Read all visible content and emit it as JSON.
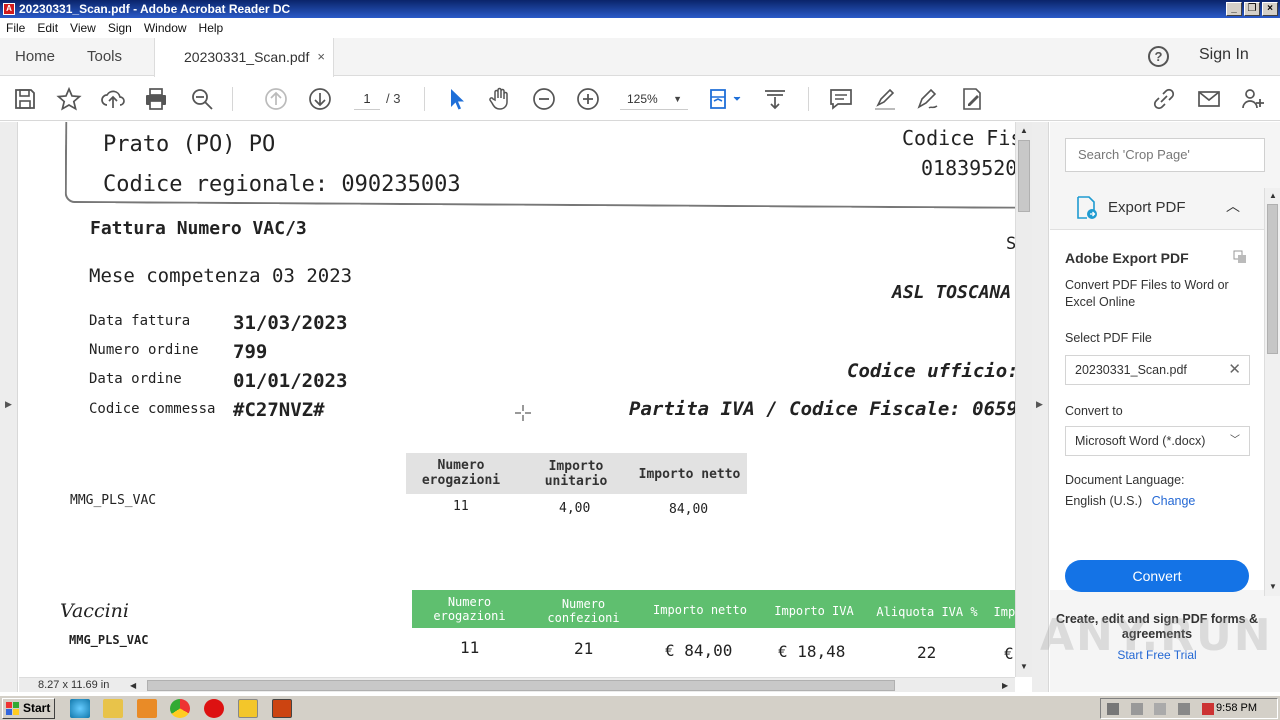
{
  "window": {
    "title": "20230331_Scan.pdf - Adobe Acrobat Reader DC"
  },
  "menu": [
    "File",
    "Edit",
    "View",
    "Sign",
    "Window",
    "Help"
  ],
  "tabs": {
    "home": "Home",
    "tools": "Tools",
    "document": "20230331_Scan.pdf",
    "close": "×"
  },
  "header": {
    "help": "?",
    "sign_in": "Sign In"
  },
  "toolbar": {
    "page_current": "1",
    "page_total": "/ 3",
    "zoom": "125%"
  },
  "document": {
    "prato": "Prato (PO) PO",
    "codice_regionale": "Codice regionale: 090235003",
    "codice_fiscale_label": "Codice Fis",
    "codice_fiscale_value": "01839520",
    "fattura": "Fattura Numero VAC/3",
    "s_char": "S",
    "mese": "Mese competenza  03 2023",
    "asl": "ASL TOSCANA",
    "fields": [
      {
        "label": "Data fattura",
        "value": "31/03/2023"
      },
      {
        "label": "Numero ordine",
        "value": "799"
      },
      {
        "label": "Data ordine",
        "value": "01/01/2023"
      },
      {
        "label": "Codice commessa",
        "value": "#C27NVZ#"
      }
    ],
    "codice_ufficio": "Codice ufficio:",
    "partita_iva": "Partita IVA / Codice Fiscale: 0659",
    "table1": {
      "headers": [
        "Numero\nerogazioni",
        "Importo\nunitario",
        "Importo netto"
      ],
      "row_label": "MMG_PLS_VAC",
      "values": [
        "11",
        "4,00",
        "84,00"
      ]
    },
    "vaccini": "Vaccini",
    "table2": {
      "headers": [
        "Numero\nerogazioni",
        "Numero\nconfezioni",
        "Importo netto",
        "Importo IVA",
        "Aliquota IVA %",
        "Impo"
      ],
      "row_label": "MMG_PLS_VAC",
      "values": [
        "11",
        "21",
        "€ 84,00",
        "€ 18,48",
        "22",
        "€"
      ]
    }
  },
  "status": {
    "page_size": "8.27 x 11.69 in"
  },
  "right_panel": {
    "search_placeholder": "Search 'Crop Page'",
    "export_label": "Export PDF",
    "card_title": "Adobe Export PDF",
    "card_desc": "Convert PDF Files to Word or Excel Online",
    "select_file": "Select PDF File",
    "file_name": "20230331_Scan.pdf",
    "convert_to_label": "Convert to",
    "convert_to_value": "Microsoft Word (*.docx)",
    "doc_lang_label": "Document Language:",
    "doc_lang_value": "English (U.S.)",
    "change": "Change",
    "convert_button": "Convert",
    "promo_text": "Create, edit and sign PDF forms & agreements",
    "trial": "Start Free Trial"
  },
  "taskbar": {
    "start": "Start",
    "clock": "9:58 PM"
  },
  "watermark": "ANY.RUN",
  "colors": {
    "accent": "#1473e6",
    "title_bar": "#0a246a",
    "green_header": "#5fbf6f"
  }
}
